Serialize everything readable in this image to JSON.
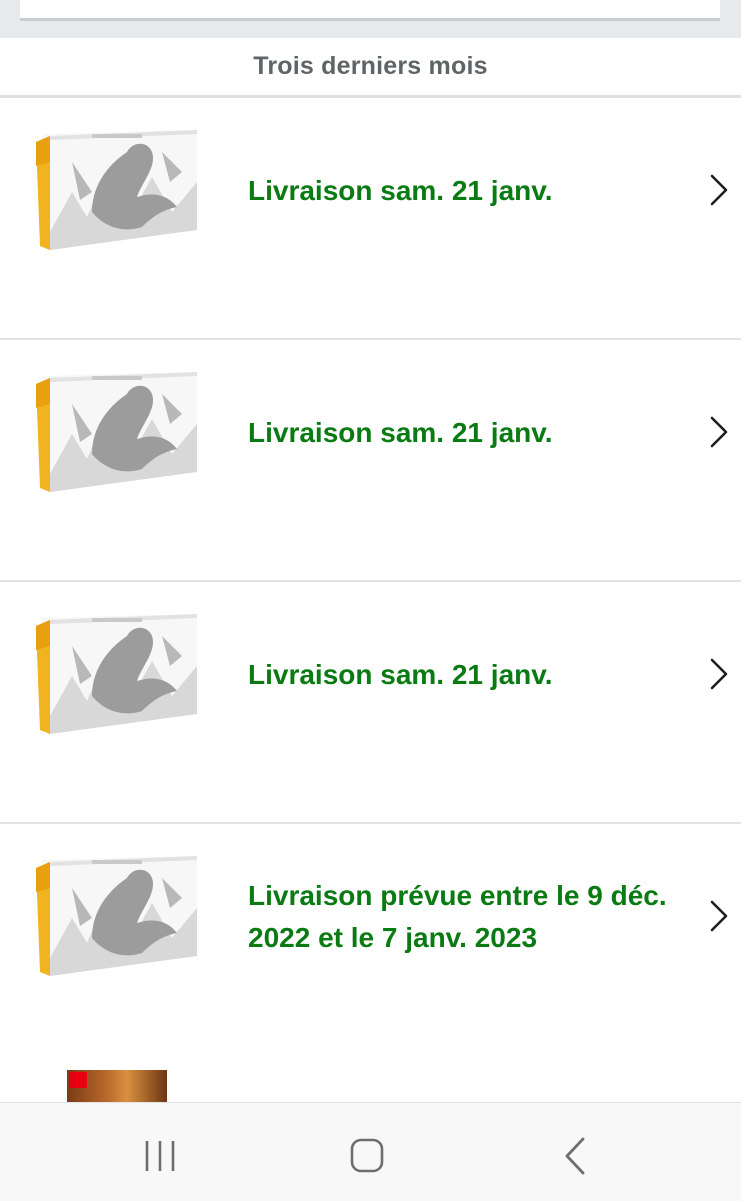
{
  "section": {
    "title": "Trois derniers mois"
  },
  "orders": [
    {
      "delivery": "Livraison sam. 21 janv.",
      "image": "charizard-ultra-premium-collection-box"
    },
    {
      "delivery": "Livraison sam. 21 janv.",
      "image": "charizard-ultra-premium-collection-box"
    },
    {
      "delivery": "Livraison sam. 21 janv.",
      "image": "charizard-ultra-premium-collection-box"
    },
    {
      "delivery": "Livraison prévue entre le 9 déc. 2022 et le 7 janv. 2023",
      "image": "charizard-ultra-premium-collection-box"
    }
  ],
  "partial_order": {
    "image": "nintendo-switch-game-cover"
  },
  "colors": {
    "delivery_text": "#0a7a12",
    "section_title": "#5f6467",
    "page_background": "#ffffff",
    "top_background": "#e7eaea"
  },
  "icons": {
    "row_chevron": "chevron-right-icon",
    "nav_recents": "recent-apps-icon",
    "nav_home": "home-icon",
    "nav_back": "back-icon"
  }
}
